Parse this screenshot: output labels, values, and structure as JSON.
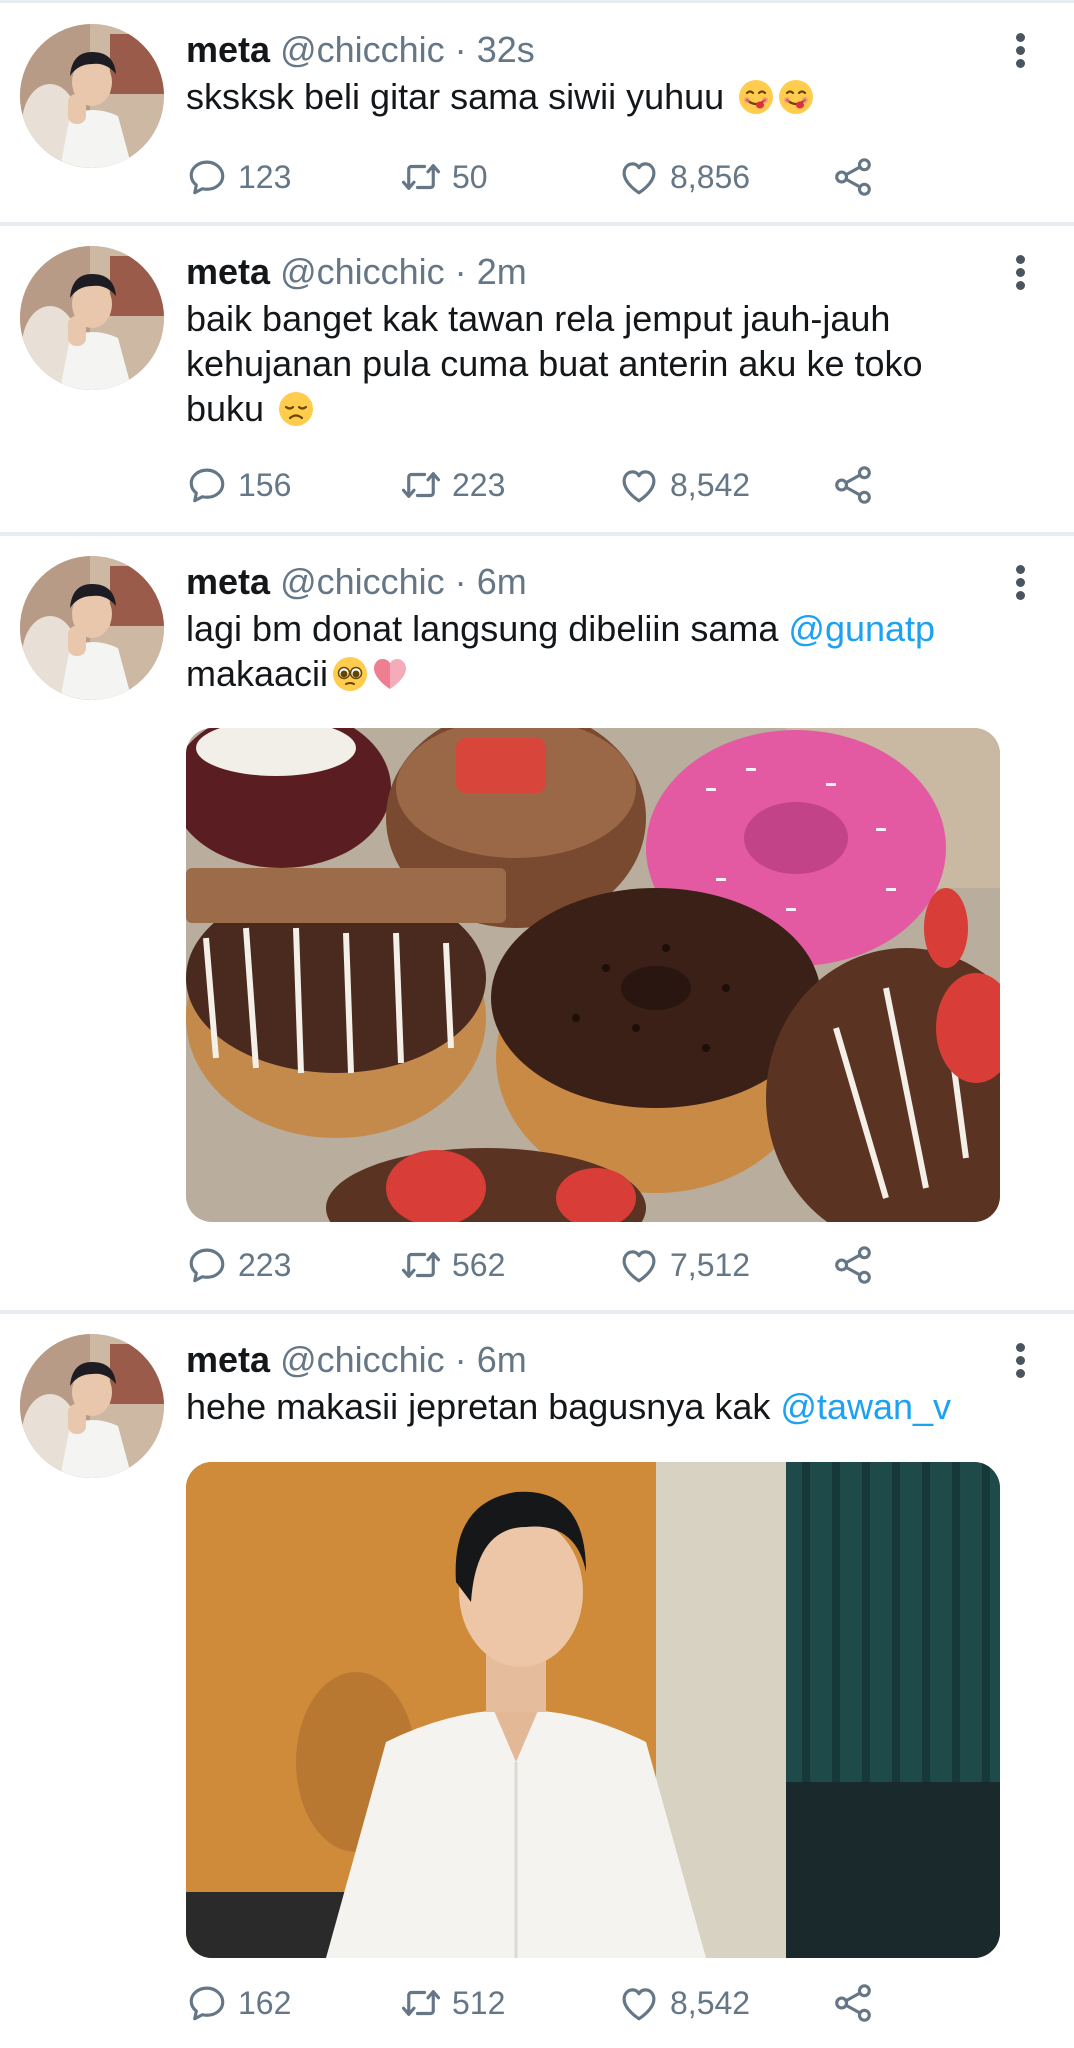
{
  "timeline": {
    "tweets": [
      {
        "name": "meta",
        "handle": "@chicchic",
        "sep": "·",
        "time": "32s",
        "text": "sksksk beli gitar sama siwii yuhuu",
        "emojis": [
          "yum-face",
          "yum-face"
        ],
        "replies": "123",
        "retweets": "50",
        "likes": "8,856"
      },
      {
        "name": "meta",
        "handle": "@chicchic",
        "sep": "·",
        "time": "2m",
        "text": "baik banget kak tawan rela jemput jauh-jauh kehujanan pula cuma buat anterin aku ke toko buku",
        "emojis": [
          "disappointed-face"
        ],
        "replies": "156",
        "retweets": "223",
        "likes": "8,542"
      },
      {
        "name": "meta",
        "handle": "@chicchic",
        "sep": "·",
        "time": "6m",
        "text_before": "lagi bm donat langsung dibeliin sama",
        "mention": "@gunatp",
        "text_after": "makaacii",
        "emojis": [
          "pleading-face",
          "pink-heart"
        ],
        "media": "donuts-photo",
        "replies": "223",
        "retweets": "562",
        "likes": "7,512"
      },
      {
        "name": "meta",
        "handle": "@chicchic",
        "sep": "·",
        "time": "6m",
        "text_before": "hehe makasii jepretan bagusnya kak",
        "mention": "@tawan_v",
        "media": "portrait-photo",
        "replies": "162",
        "retweets": "512",
        "likes": "8,542"
      }
    ]
  },
  "colors": {
    "text": "#14171a",
    "secondary": "#657786",
    "mention": "#1da1f2",
    "divider": "#e6ecf0"
  },
  "icons": [
    "reply-icon",
    "retweet-icon",
    "like-icon",
    "share-icon",
    "more-icon"
  ]
}
